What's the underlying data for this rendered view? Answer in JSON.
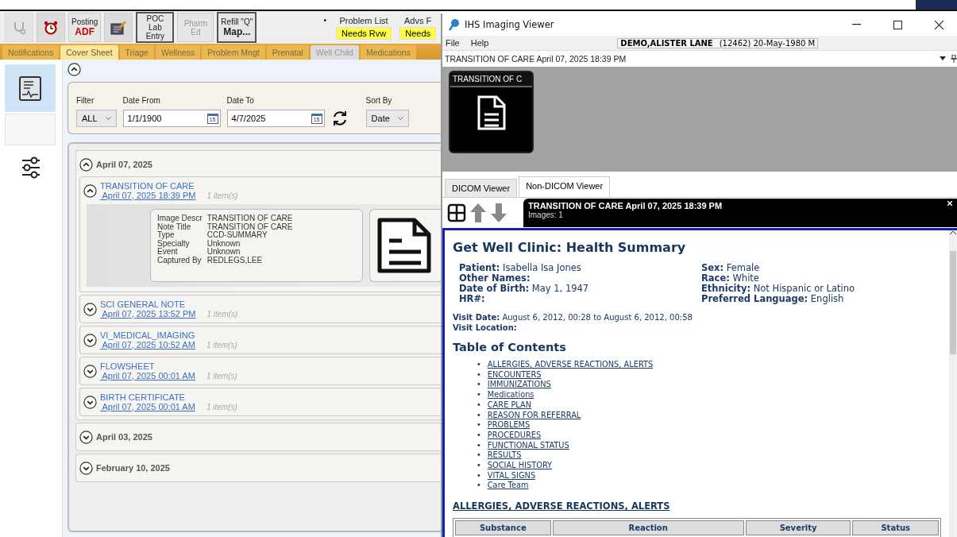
{
  "toolbar": {
    "items": [
      {
        "kind": "icon",
        "disabled": true
      },
      {
        "kind": "icon",
        "disabled": false
      },
      {
        "kind": "text",
        "label": "Posting",
        "sublabel": "ADF",
        "bordered": false,
        "disabled": false
      },
      {
        "kind": "icon",
        "disabled": false
      },
      {
        "kind": "text",
        "label": "POC Lab Entry",
        "bordered": true,
        "disabled": false
      },
      {
        "kind": "text",
        "label": "Pharm Ed",
        "bordered": false,
        "disabled": true
      },
      {
        "kind": "text",
        "label": "Refill \"Q\"",
        "sublabel": "Map...",
        "bordered": true,
        "disabled": false
      }
    ],
    "marker": "•",
    "alerts": [
      {
        "label": "Problem List",
        "badge": "Needs Rvw"
      },
      {
        "label": "Advs F",
        "badge": "Needs"
      }
    ]
  },
  "tabs": [
    {
      "label": "Notifications",
      "selected": false,
      "disabled": false
    },
    {
      "label": "Cover Sheet",
      "selected": true,
      "disabled": false
    },
    {
      "label": "Triage",
      "selected": false,
      "disabled": false
    },
    {
      "label": "Wellness",
      "selected": false,
      "disabled": false
    },
    {
      "label": "Problem Mngt",
      "selected": false,
      "disabled": false
    },
    {
      "label": "Prenatal",
      "selected": false,
      "disabled": false
    },
    {
      "label": "Well Child",
      "selected": false,
      "disabled": true
    },
    {
      "label": "Medications",
      "selected": false,
      "disabled": false
    }
  ],
  "filter": {
    "filter_label": "Filter",
    "filter_value": "ALL",
    "date_from_label": "Date From",
    "date_from": "1/1/1900",
    "date_to_label": "Date To",
    "date_to": "4/7/2025",
    "date_from_day": "15",
    "date_to_day": "15",
    "sort_label": "Sort By",
    "sort_value": "Date"
  },
  "groups": [
    {
      "date": "April 07, 2025",
      "expanded": true,
      "notes": [
        {
          "title": "TRANSITION OF CARE",
          "datetime": " April 07, 2025 18:39 PM",
          "count": "1 item(s)",
          "expanded": true,
          "details": [
            {
              "label": "Image Descr",
              "value": "TRANSITION OF CARE"
            },
            {
              "label": "Note Title",
              "value": "TRANSITION OF CARE"
            },
            {
              "label": "Type",
              "value": "CCD-SUMMARY"
            },
            {
              "label": "Specialty",
              "value": "Unknown"
            },
            {
              "label": "Event",
              "value": "Unknown"
            },
            {
              "label": "Captured By",
              "value": "REDLEGS,LEE"
            }
          ]
        },
        {
          "title": "SCI GENERAL NOTE",
          "datetime": " April 07, 2025 13:52 PM",
          "count": "1 item(s)",
          "expanded": false
        },
        {
          "title": "VI_MEDICAL_IMAGING",
          "datetime": " April 07, 2025 10:52 AM",
          "count": "1 item(s)",
          "expanded": false
        },
        {
          "title": "FLOWSHEET",
          "datetime": " April 07, 2025 00:01 AM",
          "count": "1 item(s)",
          "expanded": false
        },
        {
          "title": "BIRTH CERTIFICATE",
          "datetime": " April 07, 2025 00:01 AM",
          "count": "1 item(s)",
          "expanded": false
        }
      ]
    },
    {
      "date": "April 03, 2025",
      "expanded": false
    },
    {
      "date": "February 10, 2025",
      "expanded": false
    }
  ],
  "viewer": {
    "title": "IHS Imaging Viewer",
    "menu": [
      "File",
      "Help"
    ],
    "patient_name": "DEMO,ALISTER LANE",
    "patient_info": "(12462) 20-May-1980 M",
    "study": "TRANSITION OF CARE April 07, 2025 18:39 PM",
    "thumbnail_label": "TRANSITION OF C",
    "tabs": [
      {
        "label": "DICOM Viewer",
        "selected": false
      },
      {
        "label": "Non-DICOM Viewer",
        "selected": true
      }
    ],
    "info_title": "TRANSITION OF CARE April 07, 2025 18:39 PM",
    "info_images": "Images: 1",
    "document": {
      "heading": "Get Well Clinic: Health Summary",
      "demographics_left": [
        "**Patient:** Isabella Isa Jones",
        "**Other Names:**",
        "**Date of Birth:** May 1, 1947",
        "**HR#:**"
      ],
      "demographics_right": [
        "**Sex:** Female",
        "**Race:** White",
        "**Ethnicity:** Not Hispanic or Latino",
        "**Preferred Language:** English"
      ],
      "visit": [
        "**Visit Date:** August 6, 2012, 00:28 to August 6, 2012, 00:58",
        "**Visit Location:**"
      ],
      "toc_title": "Table of Contents",
      "bullet": "•",
      "toc": [
        "ALLERGIES, ADVERSE REACTIONS, ALERTS",
        "ENCOUNTERS",
        "IMMUNIZATIONS",
        "Medications",
        "CARE PLAN",
        "REASON FOR REFERRAL",
        "PROBLEMS",
        "PROCEDURES",
        "FUNCTIONAL STATUS",
        "RESULTS",
        "SOCIAL HISTORY",
        "VITAL SIGNS",
        "Care Team"
      ],
      "section_title": "ALLERGIES, ADVERSE REACTIONS, ALERTS",
      "table": {
        "columns": [
          "Substance",
          "Reaction",
          "Severity",
          "Status"
        ]
      }
    }
  }
}
